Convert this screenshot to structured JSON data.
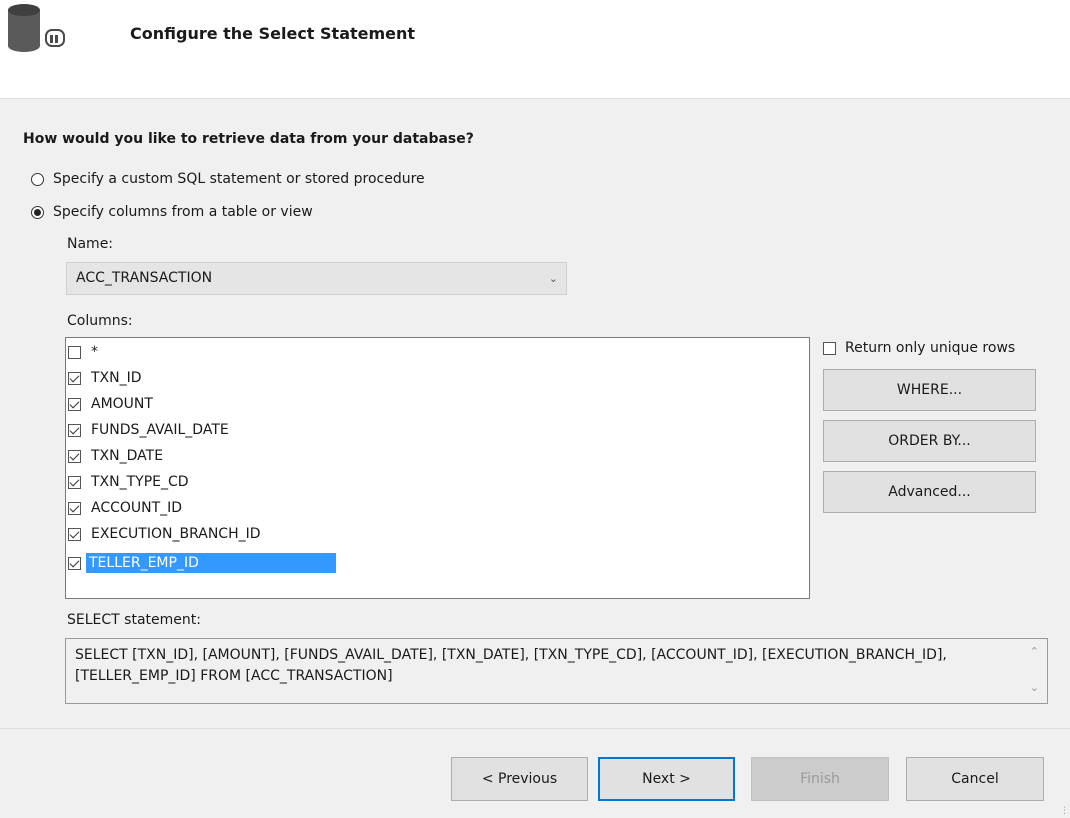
{
  "header": {
    "title": "Configure the Select Statement"
  },
  "question": "How would you like to retrieve data from your database?",
  "options": [
    {
      "label": "Specify a custom SQL statement or stored procedure",
      "selected": false
    },
    {
      "label": "Specify columns from a table or view",
      "selected": true
    }
  ],
  "name": {
    "label": "Name:",
    "value": "ACC_TRANSACTION"
  },
  "columns": {
    "label": "Columns:",
    "items": [
      {
        "label": "*",
        "checked": false
      },
      {
        "label": "TXN_ID",
        "checked": true
      },
      {
        "label": "AMOUNT",
        "checked": true
      },
      {
        "label": "FUNDS_AVAIL_DATE",
        "checked": true
      },
      {
        "label": "TXN_DATE",
        "checked": true
      },
      {
        "label": "TXN_TYPE_CD",
        "checked": true
      },
      {
        "label": "ACCOUNT_ID",
        "checked": true
      },
      {
        "label": "EXECUTION_BRANCH_ID",
        "checked": true
      },
      {
        "label": "TELLER_EMP_ID",
        "checked": true,
        "selected": true
      }
    ]
  },
  "side": {
    "unique_rows_label": "Return only unique rows",
    "unique_rows_checked": false,
    "where_label": "WHERE...",
    "order_by_label": "ORDER BY...",
    "advanced_label": "Advanced..."
  },
  "select_statement": {
    "label": "SELECT statement:",
    "text": "SELECT [TXN_ID], [AMOUNT], [FUNDS_AVAIL_DATE], [TXN_DATE], [TXN_TYPE_CD], [ACCOUNT_ID], [EXECUTION_BRANCH_ID], [TELLER_EMP_ID] FROM [ACC_TRANSACTION]"
  },
  "footer": {
    "previous_label": "< Previous",
    "next_label": "Next >",
    "finish_label": "Finish",
    "cancel_label": "Cancel"
  },
  "icons": {
    "header": "database-icon",
    "dropdown": "chevron-down-icon"
  },
  "colors": {
    "selection": "#3399ff",
    "focus_border": "#0078d7"
  }
}
